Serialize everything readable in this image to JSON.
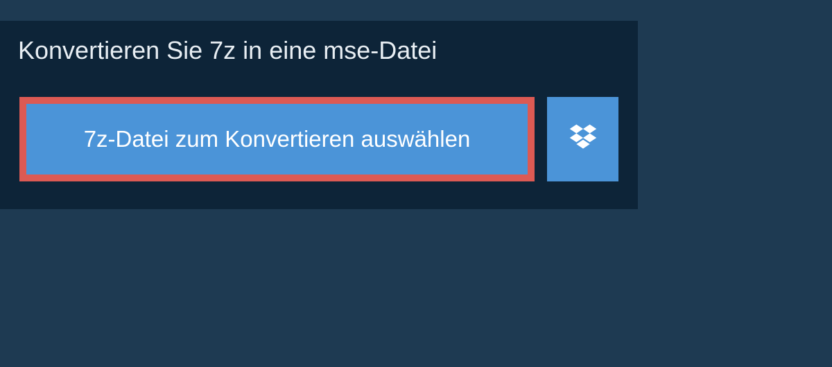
{
  "title": "Konvertieren Sie 7z in eine mse-Datei",
  "select_button_label": "7z-Datei zum Konvertieren auswählen",
  "colors": {
    "page_bg": "#1e3a52",
    "panel_bg": "#0d2438",
    "button_bg": "#4b94d8",
    "highlight_border": "#dc5a54",
    "text_light": "#ffffff"
  }
}
